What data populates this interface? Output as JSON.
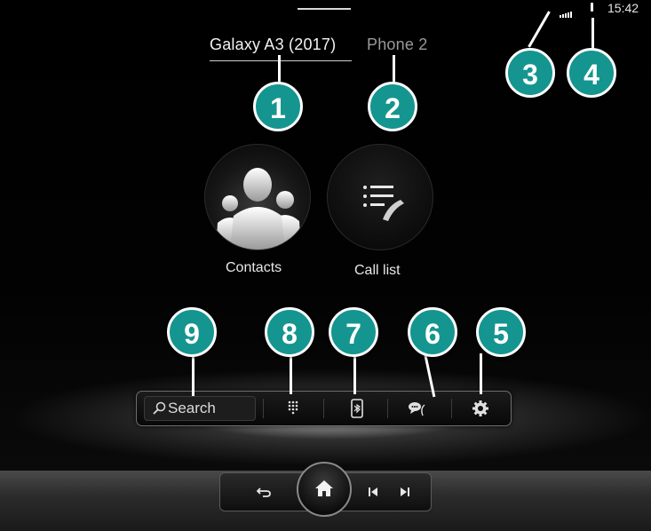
{
  "status_bar": {
    "time": "15:42",
    "icons": [
      "signal-icon",
      "battery-icon"
    ]
  },
  "phones": {
    "active": "Galaxy A3 (2017)",
    "inactive": "Phone 2"
  },
  "tiles": {
    "contacts_label": "Contacts",
    "call_list_label": "Call list"
  },
  "toolbar": {
    "search_label": "Search",
    "icons": [
      "search-icon",
      "keypad-icon",
      "phone-sync-icon",
      "messages-icon",
      "settings-icon"
    ]
  },
  "nav": {
    "icons": [
      "back-icon",
      "home-icon",
      "previous-icon",
      "next-icon"
    ]
  },
  "callouts": [
    "1",
    "2",
    "3",
    "4",
    "5",
    "6",
    "7",
    "8",
    "9"
  ],
  "colors": {
    "callout": "#15958f",
    "background": "#000000",
    "text": "#f2f2f2",
    "inactive_text": "#9a9a9a"
  }
}
